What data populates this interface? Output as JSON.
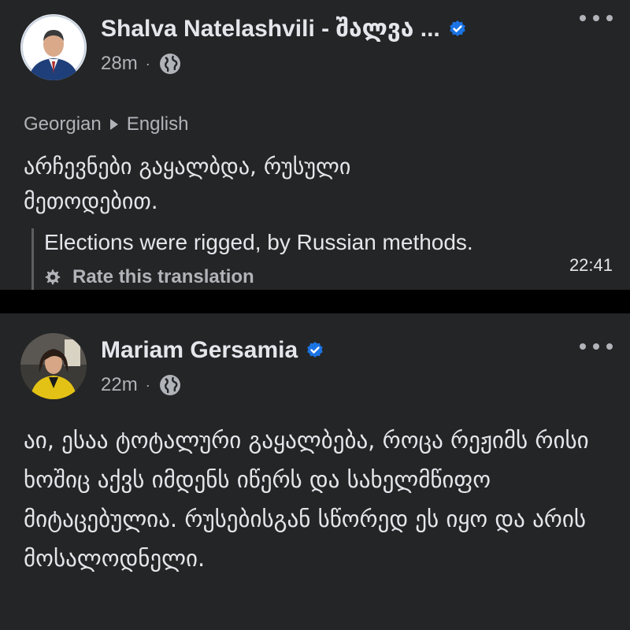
{
  "colors": {
    "card_bg": "#242526",
    "divider": "#000000",
    "primary_text": "#e4e6eb",
    "secondary_text": "#b0b3b8",
    "verified_badge": "#1b74e4"
  },
  "posts": [
    {
      "author": "Shalva Natelashvili -  შალვა ...",
      "verified": true,
      "time": "28m",
      "audience_icon": "globe-icon",
      "more_icon": "more-options-icon",
      "translation": {
        "from": "Georgian",
        "to": "English",
        "original": "არჩევნები გაყალბდა, რუსული მეთოდებით.",
        "translated": "Elections were rigged, by Russian methods.",
        "rate_label": "Rate this translation"
      },
      "timestamp": "22:41"
    },
    {
      "author": "Mariam Gersamia",
      "verified": true,
      "time": "22m",
      "audience_icon": "globe-icon",
      "more_icon": "more-options-icon",
      "text": "აი, ესაა ტოტალური გაყალბება, როცა რეჟიმს რისი ხოშიც აქვს იმდენს იწერს და სახელმწიფო მიტაცებულია. რუსებისგან სწორედ ეს იყო და არის მოსალოდნელი."
    }
  ]
}
